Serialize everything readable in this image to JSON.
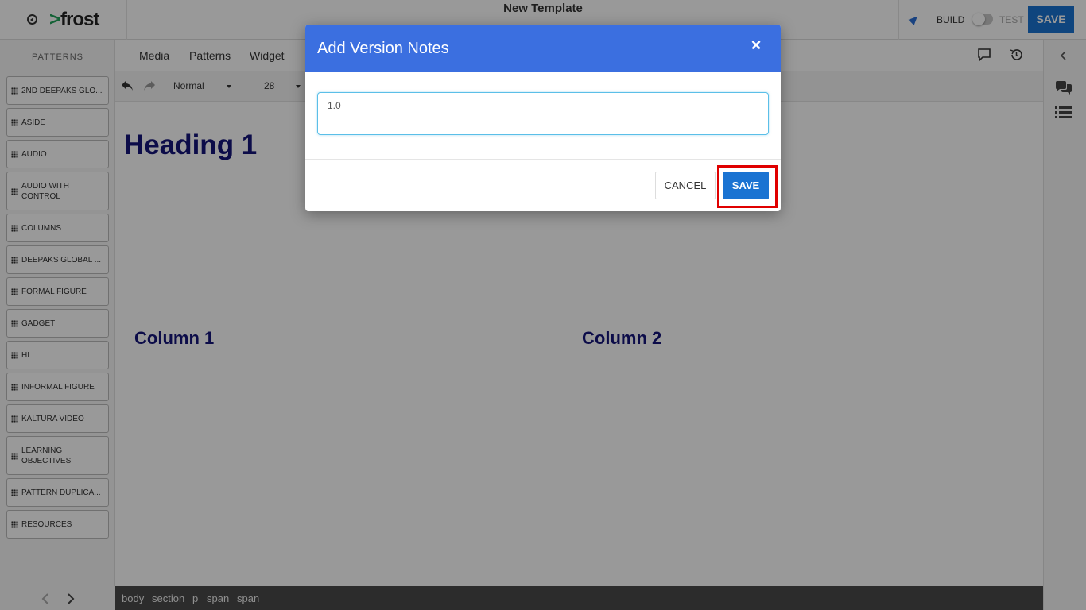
{
  "header": {
    "logo_text": "frost",
    "page_title": "New Template",
    "build_label": "BUILD",
    "test_label": "TEST",
    "save_label": "SAVE"
  },
  "left_panel": {
    "title": "PATTERNS",
    "items": [
      "2ND DEEPAKS GLO...",
      "ASIDE",
      "AUDIO",
      "AUDIO WITH CONTROL",
      "COLUMNS",
      "DEEPAKS GLOBAL ...",
      "FORMAL FIGURE",
      "GADGET",
      "HI",
      "INFORMAL FIGURE",
      "KALTURA VIDEO",
      "LEARNING OBJECTIVES",
      "PATTERN DUPLICA...",
      "RESOURCES"
    ]
  },
  "tabs": [
    "Media",
    "Patterns",
    "Widget"
  ],
  "format_toolbar": {
    "style_value": "Normal",
    "size_value": "28"
  },
  "canvas": {
    "heading": "Heading 1",
    "column1": "Column 1",
    "column2": "Column 2"
  },
  "breadcrumb": [
    "body",
    "section",
    "p",
    "span",
    "span"
  ],
  "modal": {
    "title": "Add Version Notes",
    "close_symbol": "×",
    "input_value": "1.0",
    "cancel_label": "CANCEL",
    "save_label": "SAVE"
  },
  "colors": {
    "primary": "#1a73d2",
    "modal_header": "#3b6fe0",
    "heading_text": "#14147a",
    "highlight": "#e00000"
  }
}
